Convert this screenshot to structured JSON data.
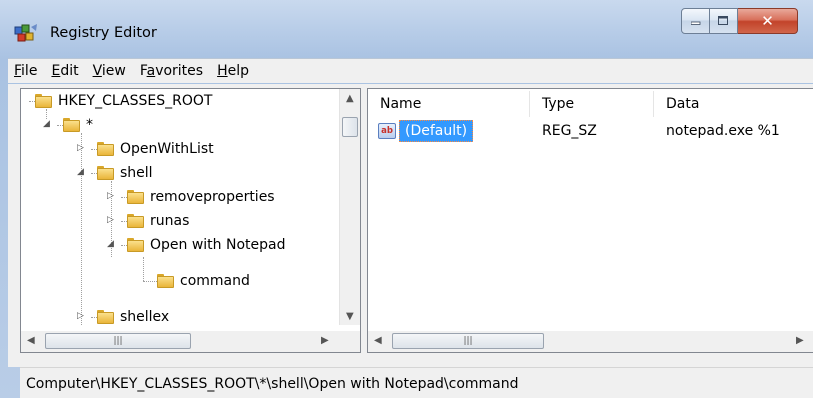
{
  "window": {
    "title": "Registry Editor",
    "accent": "#a9c2e2"
  },
  "menu": [
    {
      "key": "F",
      "rest": "ile"
    },
    {
      "key": "E",
      "rest": "dit"
    },
    {
      "key": "V",
      "rest": "iew"
    },
    {
      "pre": "F",
      "key": "a",
      "rest": "vorites"
    },
    {
      "key": "H",
      "rest": "elp"
    }
  ],
  "tree": {
    "nodes": [
      {
        "label": "HKEY_CLASSES_ROOT",
        "expander": "none"
      },
      {
        "label": "*",
        "expander": "expanded"
      },
      {
        "label": "OpenWithList",
        "expander": "collapsed"
      },
      {
        "label": "shell",
        "expander": "expanded"
      },
      {
        "label": "removeproperties",
        "expander": "collapsed"
      },
      {
        "label": "runas",
        "expander": "collapsed"
      },
      {
        "label": "Open with Notepad",
        "expander": "expanded"
      },
      {
        "label": "command",
        "expander": "none"
      },
      {
        "label": "shellex",
        "expander": "collapsed"
      }
    ]
  },
  "list": {
    "columns": [
      "Name",
      "Type",
      "Data"
    ],
    "rows": [
      {
        "name": "(Default)",
        "type": "REG_SZ",
        "data": "notepad.exe %1",
        "icon": "ab"
      }
    ]
  },
  "statusbar": {
    "path": "Computer\\HKEY_CLASSES_ROOT\\*\\shell\\Open with Notepad\\command"
  }
}
